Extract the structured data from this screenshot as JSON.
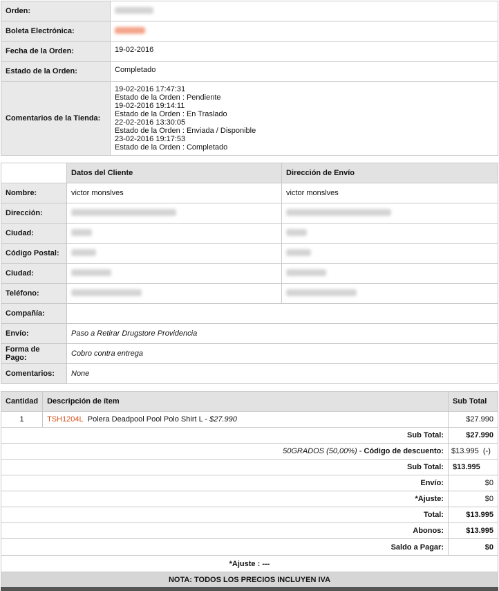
{
  "order": {
    "rows": {
      "orden_label": "Orden:",
      "boleta_label": "Boleta Electrónica:",
      "fecha_label": "Fecha de la Orden:",
      "fecha_value": "19-02-2016",
      "estado_label": "Estado de la Orden:",
      "estado_value": "Completado",
      "comentarios_label": "Comentarios de la Tienda:"
    },
    "history": [
      "19-02-2016 17:47:31",
      "Estado de la Orden : Pendiente",
      "19-02-2016 19:14:11",
      "Estado de la Orden : En Traslado",
      "22-02-2016 13:30:05",
      "Estado de la Orden : Enviada / Disponible",
      "23-02-2016 19:17:53",
      "Estado de la Orden : Completado"
    ]
  },
  "customer": {
    "col_cliente": "Datos del Cliente",
    "col_envio": "Dirección de Envío",
    "nombre_label": "Nombre:",
    "nombre_cliente": "victor monslves",
    "nombre_envio": "victor monslves",
    "direccion_label": "Dirección:",
    "ciudad_label": "Ciudad:",
    "postal_label": "Código Postal:",
    "ciudad2_label": "Ciudad:",
    "telefono_label": "Teléfono:",
    "compania_label": "Compañía:",
    "envio_label": "Envío:",
    "envio_value": "Paso a Retirar Drugstore Providencia",
    "pago_label": "Forma de Pago:",
    "pago_value": "Cobro contra entrega",
    "comentarios_label": "Comentarios:",
    "comentarios_value": "None"
  },
  "items": {
    "col_cantidad": "Cantidad",
    "col_desc": "Descripción de ítem",
    "col_subtotal": "Sub Total",
    "rows": [
      {
        "qty": "1",
        "sku": "TSH1204L",
        "name": "Polera Deadpool Pool Polo Shirt L - ",
        "price": "$27.990",
        "subtotal": "$27.990"
      }
    ]
  },
  "totals": {
    "subtotal1_label": "Sub Total:",
    "subtotal1_value": "$27.990",
    "discount_code": "50GRADOS (50,00%)",
    "discount_sep": " - ",
    "discount_label": "Código de descuento:",
    "discount_value": "$13.995  (-)",
    "subtotal2_label": "Sub Total:",
    "subtotal2_value": "$13.995",
    "envio_label": "Envío:",
    "envio_value": "$0",
    "ajuste_label": "*Ajuste:",
    "ajuste_value": "$0",
    "total_label": "Total:",
    "total_value": "$13.995",
    "abonos_label": "Abonos:",
    "abonos_value": "$13.995",
    "saldo_label": "Saldo a Pagar:",
    "saldo_value": "$0",
    "ajuste_note": "*Ajuste : ---",
    "nota": "NOTA: TODOS LOS PRECIOS INCLUYEN IVA"
  }
}
